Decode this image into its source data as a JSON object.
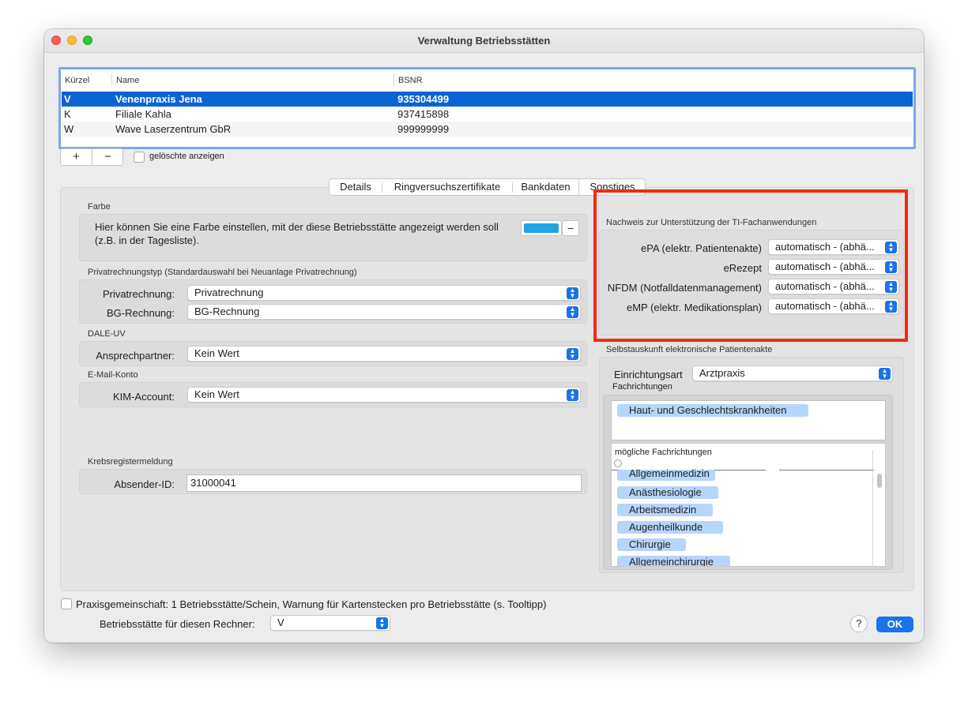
{
  "window": {
    "title": "Verwaltung Betriebsstätten"
  },
  "table": {
    "columns": [
      "Kürzel",
      "Name",
      "BSNR"
    ],
    "rows": [
      {
        "kuerzel": "V",
        "name": "Venenpraxis Jena",
        "bsnr": "935304499"
      },
      {
        "kuerzel": "K",
        "name": "Filiale Kahla",
        "bsnr": "937415898"
      },
      {
        "kuerzel": "W",
        "name": "Wave Laserzentrum GbR",
        "bsnr": "999999999"
      }
    ]
  },
  "toolbar": {
    "add_label": "+",
    "remove_label": "−",
    "show_deleted_label": "gelöschte anzeigen"
  },
  "tabs": [
    "Details",
    "Ringversuchszertifikate",
    "Bankdaten",
    "Sonstiges"
  ],
  "farbe": {
    "section": "Farbe",
    "text": "Hier können Sie eine Farbe einstellen, mit der diese Betriebsstätte angezeigt werden soll (z.B. in der Tagesliste).",
    "swatch_color": "#1ea5e6",
    "clear_label": "−"
  },
  "privat": {
    "section": "Privatrechnungstyp (Standardauswahl bei Neuanlage Privatrechnung)",
    "privat_label": "Privatrechnung:",
    "privat_value": "Privatrechnung",
    "bg_label": "BG-Rechnung:",
    "bg_value": "BG-Rechnung"
  },
  "dale": {
    "section": "DALE-UV",
    "label": "Ansprechpartner:",
    "value": "Kein Wert"
  },
  "email": {
    "section": "E-Mail-Konto",
    "label": "KIM-Account:",
    "value": "Kein Wert"
  },
  "krebs": {
    "section": "Krebsregistermeldung",
    "label": "Absender-ID:",
    "value": "31000041"
  },
  "ti": {
    "section": "Nachweis zur Unterstützung der TI-Fachanwendungen",
    "items": [
      {
        "label": "ePA (elektr. Patientenakte)",
        "value": "automatisch - (abhä..."
      },
      {
        "label": "eRezept",
        "value": "automatisch - (abhä..."
      },
      {
        "label": "NFDM (Notfalldatenmanagement)",
        "value": "automatisch - (abhä..."
      },
      {
        "label": "eMP (elektr. Medikationsplan)",
        "value": "automatisch - (abhä..."
      }
    ]
  },
  "epa": {
    "section": "Selbstauskunft elektronische Patientenakte",
    "einrichtung_label": "Einrichtungsart",
    "einrichtung_value": "Arztpraxis",
    "fach_label": "Fachrichtungen",
    "selected": [
      "Haut- und Geschlechtskrankheiten"
    ],
    "moegliche_label": "mögliche Fachrichtungen",
    "moegliche": [
      "Allgemeinmedizin",
      "Anästhesiologie",
      "Arbeitsmedizin",
      "Augenheilkunde",
      "Chirurgie",
      "Allgemeinchirurgie"
    ]
  },
  "footer": {
    "praxis_label": "Praxisgemeinschaft: 1 Betriebsstätte/Schein, Warnung für Kartenstecken pro Betriebsstätte (s. Tooltipp)",
    "rechner_label": "Betriebsstätte für diesen Rechner:",
    "rechner_value": "V",
    "help_label": "?",
    "ok_label": "OK"
  },
  "colors": {
    "accent": "#1a73e8",
    "selection": "#0b63d6",
    "highlight": "#f12b16",
    "chip": "#b6d5fb"
  }
}
